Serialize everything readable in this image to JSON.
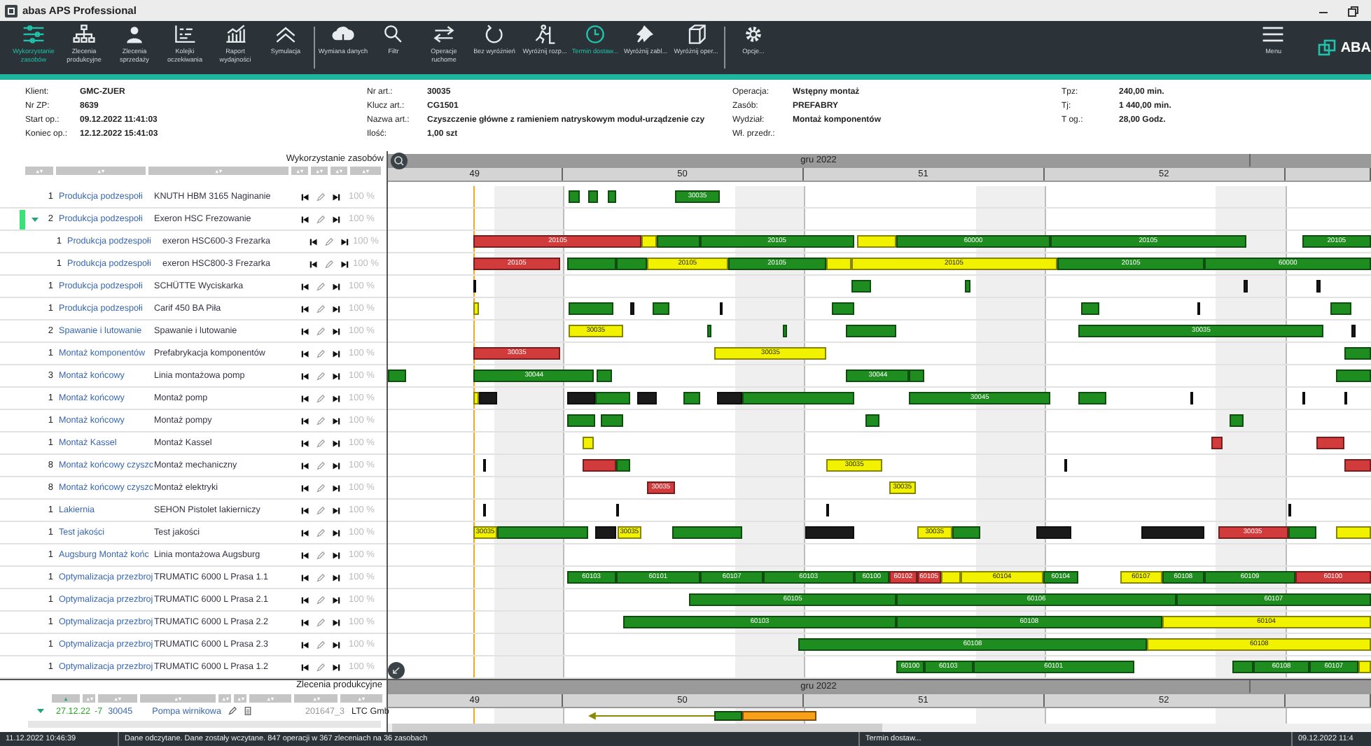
{
  "window": {
    "title": "abas APS Professional"
  },
  "toolbar": {
    "groups": [
      [
        {
          "label": "Wykorzystanie zasobów",
          "kind": "sliders",
          "selected": true
        },
        {
          "label": "Zlecenia produkcyjne",
          "kind": "org",
          "selected": false
        },
        {
          "label": "Zlecenia sprzedaży",
          "kind": "person",
          "selected": false
        },
        {
          "label": "Kolejki oczekiwania",
          "kind": "queue",
          "selected": false
        },
        {
          "label": "Raport wydajności",
          "kind": "chart",
          "selected": false
        },
        {
          "label": "Symulacja",
          "kind": "chevrons",
          "selected": false
        }
      ],
      [
        {
          "label": "Wymiana danych",
          "kind": "cloud",
          "selected": false
        },
        {
          "label": "Filtr",
          "kind": "search",
          "selected": false
        },
        {
          "label": "Operacje ruchome",
          "kind": "arrows",
          "selected": false
        },
        {
          "label": "Bez wyróżnień",
          "kind": "refresh",
          "selected": false
        },
        {
          "label": "Wyróżnij rozp...",
          "kind": "runner",
          "selected": false
        },
        {
          "label": "Termin dostaw...",
          "kind": "clock",
          "selected": true
        },
        {
          "label": "Wyróżnij zabl...",
          "kind": "pin",
          "selected": false
        },
        {
          "label": "Wyróżnij oper...",
          "kind": "cube",
          "selected": false
        }
      ],
      [
        {
          "label": "Opcje...",
          "kind": "gear",
          "selected": false
        }
      ]
    ],
    "menu": "Menu",
    "logo": "ABA"
  },
  "info": {
    "columns": [
      [
        {
          "label": "Klient:",
          "value": "GMC-ZUER"
        },
        {
          "label": "Nr ZP:",
          "value": "8639"
        },
        {
          "label": "Start op.:",
          "value": "09.12.2022 11:41:03"
        },
        {
          "label": "Koniec op.:",
          "value": "12.12.2022 15:41:03"
        }
      ],
      [
        {
          "label": "Nr art.:",
          "value": "30035"
        },
        {
          "label": "Klucz art.:",
          "value": "CG1501"
        },
        {
          "label": "Nazwa art.:",
          "value": "Czyszczenie główne z ramieniem natryskowym moduł-urządzenie czy"
        },
        {
          "label": "Ilość:",
          "value": "1,00 szt"
        }
      ],
      [
        {
          "label": "Operacja:",
          "value": "Wstępny montaż"
        },
        {
          "label": "Zasób:",
          "value": "PREFABRY"
        },
        {
          "label": "Wydział:",
          "value": "Montaż komponentów"
        },
        {
          "label": "Wł. przedr.:"
        }
      ],
      [
        {
          "label": "Tpz:",
          "value": "240,00 min."
        },
        {
          "label": "Tj:",
          "value": "1 440,00 min."
        },
        {
          "label": "T og.:",
          "value": "28,00 Godz."
        }
      ]
    ]
  },
  "resources": {
    "title": "Wykorzystanie zasobów",
    "timeline": {
      "month": "gru 2022",
      "weeks": [
        "49",
        "50",
        "51",
        "52"
      ]
    },
    "rows": [
      {
        "count": "1",
        "group": "Produkcja podzespołi",
        "resource": "KNUTH HBM 3165 Naginanie",
        "load": "100 %",
        "selected": false,
        "bars": [
          {
            "color": "#1e8c1e"
          },
          {
            "color": "#1e8c1e"
          },
          {
            "color": "#1e8c1e"
          },
          {
            "color": "#1e8c1e",
            "label": "30035"
          }
        ]
      },
      {
        "count": "2",
        "group": "Produkcja podzespołi",
        "resource": "Exeron HSC  Frezowanie",
        "load": "100 %",
        "selected": true,
        "expanded": true,
        "bars": [],
        "children": [
          {
            "count": "1",
            "group": "Produkcja podzespołi",
            "resource": "exeron HSC600-3 Frezarka",
            "load": "100 %",
            "bars": [
              {
                "color": "#d23b3b",
                "label": "20105"
              },
              {
                "color": "#f2f200"
              },
              {
                "color": "#1e8c1e"
              },
              {
                "color": "#1e8c1e",
                "label": "20105"
              },
              {
                "color": "#f2f200"
              },
              {
                "color": "#1e8c1e",
                "label": "60000"
              },
              {
                "color": "#1e8c1e",
                "label": "20105"
              },
              {
                "color": "#1e8c1e",
                "label": "20105"
              }
            ]
          },
          {
            "count": "1",
            "group": "Produkcja podzespołi",
            "resource": "exeron HSC800-3 Frezarka",
            "load": "100 %",
            "bars": [
              {
                "color": "#d23b3b",
                "label": "20105"
              },
              {
                "color": "#1e8c1e"
              },
              {
                "color": "#1e8c1e"
              },
              {
                "color": "#f2f200",
                "label": "20105"
              },
              {
                "color": "#1e8c1e",
                "label": "20105"
              },
              {
                "color": "#f2f200"
              },
              {
                "color": "#f2f200",
                "label": "20105"
              },
              {
                "color": "#1e8c1e",
                "label": "20105"
              },
              {
                "color": "#1e8c1e",
                "label": "60000"
              }
            ]
          }
        ]
      },
      {
        "count": "1",
        "group": "Produkcja podzespołi",
        "resource": "SCHÜTTE Wyciskarka",
        "load": "100 %",
        "selected": false,
        "bars": [
          {
            "color": "#1a1a1a"
          },
          {
            "color": "#1e8c1e"
          },
          {
            "color": "#1e8c1e"
          },
          {
            "color": "#1a1a1a"
          },
          {
            "color": "#1a1a1a"
          }
        ]
      },
      {
        "count": "1",
        "group": "Produkcja podzespołi",
        "resource": "Carif 450 BA Piła",
        "load": "100 %",
        "selected": false,
        "bars": [
          {
            "color": "#f2f200"
          },
          {
            "color": "#1e8c1e"
          },
          {
            "color": "#1a1a1a"
          },
          {
            "color": "#1e8c1e"
          },
          {
            "color": "#1a1a1a"
          },
          {
            "color": "#1e8c1e"
          },
          {
            "color": "#1e8c1e"
          },
          {
            "color": "#1a1a1a"
          },
          {
            "color": "#1e8c1e"
          }
        ]
      },
      {
        "count": "2",
        "group": "Spawanie i lutowanie",
        "resource": "Spawanie i lutowanie",
        "load": "100 %",
        "selected": false,
        "bars": [
          {
            "color": "#f2f200",
            "label": "30035"
          },
          {
            "color": "#1e8c1e"
          },
          {
            "color": "#1e8c1e"
          },
          {
            "color": "#1e8c1e"
          },
          {
            "color": "#1e8c1e",
            "label": "30035"
          },
          {
            "color": "#1a1a1a"
          }
        ]
      },
      {
        "count": "1",
        "group": "Montaż komponentów",
        "resource": "Prefabrykacja komponentów",
        "load": "100 %",
        "selected": false,
        "bars": [
          {
            "color": "#d23b3b",
            "label": "30035"
          },
          {
            "color": "#f2f200",
            "label": "30035"
          },
          {
            "color": "#1e8c1e"
          }
        ]
      },
      {
        "count": "3",
        "group": "Montaż końcowy",
        "resource": "Linia montażowa pomp",
        "load": "100 %",
        "selected": false,
        "bars": [
          {
            "color": "#1e8c1e"
          },
          {
            "color": "#1e8c1e",
            "label": "30044"
          },
          {
            "color": "#1e8c1e"
          },
          {
            "color": "#1e8c1e",
            "label": "30044"
          },
          {
            "color": "#1e8c1e"
          },
          {
            "color": "#1e8c1e"
          }
        ]
      },
      {
        "count": "1",
        "group": "Montaż końcowy",
        "resource": "Montaż pomp",
        "load": "100 %",
        "selected": false,
        "bars": [
          {
            "color": "#f2f200"
          },
          {
            "color": "#1a1a1a"
          },
          {
            "color": "#1a1a1a"
          },
          {
            "color": "#1e8c1e"
          },
          {
            "color": "#1a1a1a"
          },
          {
            "color": "#1e8c1e"
          },
          {
            "color": "#1a1a1a"
          },
          {
            "color": "#1e8c1e"
          },
          {
            "color": "#1e8c1e",
            "label": "30045"
          },
          {
            "color": "#1e8c1e"
          },
          {
            "color": "#1a1a1a"
          },
          {
            "color": "#1a1a1a"
          },
          {
            "color": "#1a1a1a"
          }
        ]
      },
      {
        "count": "1",
        "group": "Montaż końcowy",
        "resource": "Montaż pompy",
        "load": "100 %",
        "selected": false,
        "bars": [
          {
            "color": "#1e8c1e"
          },
          {
            "color": "#1e8c1e"
          },
          {
            "color": "#1e8c1e"
          },
          {
            "color": "#1e8c1e"
          }
        ]
      },
      {
        "count": "1",
        "group": "Montaż Kassel",
        "resource": "Montaż Kassel",
        "load": "100 %",
        "selected": false,
        "bars": [
          {
            "color": "#f2f200"
          },
          {
            "color": "#d23b3b"
          },
          {
            "color": "#d23b3b"
          }
        ]
      },
      {
        "count": "8",
        "group": "Montaż końcowy czyszc",
        "resource": "Montaż mechaniczny",
        "load": "100 %",
        "selected": false,
        "bars": [
          {
            "color": "#1a1a1a"
          },
          {
            "color": "#d23b3b"
          },
          {
            "color": "#1e8c1e"
          },
          {
            "color": "#f2f200",
            "label": "30035"
          },
          {
            "color": "#1a1a1a"
          },
          {
            "color": "#d23b3b"
          }
        ]
      },
      {
        "count": "8",
        "group": "Montaż końcowy czyszc",
        "resource": "Montaż elektryki",
        "load": "100 %",
        "selected": false,
        "bars": [
          {
            "color": "#d23b3b",
            "label": "30035"
          },
          {
            "color": "#f2f200",
            "label": "30035"
          }
        ]
      },
      {
        "count": "1",
        "group": "Lakiernia",
        "resource": "SEHON Pistolet lakierniczy",
        "load": "100 %",
        "selected": false,
        "bars": [
          {
            "color": "#1a1a1a"
          },
          {
            "color": "#1a1a1a"
          },
          {
            "color": "#1a1a1a"
          },
          {
            "color": "#1a1a1a"
          }
        ]
      },
      {
        "count": "1",
        "group": "Test jakości",
        "resource": "Test jakości",
        "load": "100 %",
        "selected": false,
        "bars": [
          {
            "color": "#f2f200",
            "label": "30035"
          },
          {
            "color": "#1e8c1e"
          },
          {
            "color": "#1a1a1a"
          },
          {
            "color": "#f2f200",
            "label": "30035"
          },
          {
            "color": "#1e8c1e"
          },
          {
            "color": "#1a1a1a"
          },
          {
            "color": "#f2f200",
            "label": "30035"
          },
          {
            "color": "#1e8c1e"
          },
          {
            "color": "#1a1a1a"
          },
          {
            "color": "#1a1a1a"
          },
          {
            "color": "#d23b3b",
            "label": "30035"
          },
          {
            "color": "#1e8c1e"
          },
          {
            "color": "#f2f200"
          }
        ]
      },
      {
        "count": "1",
        "group": "Augsburg Montaż końc",
        "resource": "Linia montażowa Augsburg",
        "load": "100 %",
        "selected": false,
        "bars": []
      },
      {
        "count": "1",
        "group": "Optymalizacja przezbroj",
        "resource": "TRUMATIC 6000 L Prasa 1.1",
        "load": "100 %",
        "selected": false,
        "bars": [
          {
            "color": "#1e8c1e",
            "label": "60103"
          },
          {
            "color": "#1e8c1e",
            "label": "60101"
          },
          {
            "color": "#1e8c1e",
            "label": "60107"
          },
          {
            "color": "#1e8c1e",
            "label": "60103"
          },
          {
            "color": "#1e8c1e",
            "label": "60100"
          },
          {
            "color": "#d23b3b",
            "label": "60102"
          },
          {
            "color": "#d23b3b",
            "label": "60105"
          },
          {
            "color": "#f2f200"
          },
          {
            "color": "#f2f200",
            "label": "60104"
          },
          {
            "color": "#1e8c1e",
            "label": "60104"
          },
          {
            "color": "#f2f200",
            "label": "60107"
          },
          {
            "color": "#1e8c1e",
            "label": "60108"
          },
          {
            "color": "#1e8c1e",
            "label": "60109"
          },
          {
            "color": "#d23b3b",
            "label": "60100"
          }
        ]
      },
      {
        "count": "1",
        "group": "Optymalizacja przezbroj",
        "resource": "TRUMATIC 6000 L Prasa 2.1",
        "load": "100 %",
        "selected": false,
        "bars": [
          {
            "color": "#1e8c1e",
            "label": "60105"
          },
          {
            "color": "#1e8c1e",
            "label": "60106"
          },
          {
            "color": "#1e8c1e",
            "label": "60107"
          }
        ]
      },
      {
        "count": "1",
        "group": "Optymalizacja przezbroj",
        "resource": "TRUMATIC 6000 L Prasa 2.2",
        "load": "100 %",
        "selected": false,
        "bars": [
          {
            "color": "#1e8c1e",
            "label": "60103"
          },
          {
            "color": "#1e8c1e",
            "label": "60108"
          },
          {
            "color": "#f2f200",
            "label": "60104"
          }
        ]
      },
      {
        "count": "1",
        "group": "Optymalizacja przezbroj",
        "resource": "TRUMATIC 6000 L Prasa 2.3",
        "load": "100 %",
        "selected": false,
        "bars": [
          {
            "color": "#1e8c1e",
            "label": "60108"
          },
          {
            "color": "#f2f200",
            "label": "60108"
          }
        ]
      },
      {
        "count": "1",
        "group": "Optymalizacja przezbroj",
        "resource": "TRUMATIC 6000 L Prasa 1.2",
        "load": "100 %",
        "selected": false,
        "bars": [
          {
            "color": "#1e8c1e",
            "label": "60100"
          },
          {
            "color": "#1e8c1e",
            "label": "60103"
          },
          {
            "color": "#1e8c1e",
            "label": "60101"
          },
          {
            "color": "#1e8c1e"
          },
          {
            "color": "#1e8c1e",
            "label": "60108"
          },
          {
            "color": "#1e8c1e",
            "label": "60107"
          },
          {
            "color": "#f2f200"
          }
        ]
      }
    ]
  },
  "orders": {
    "title": "Zlecenia produkcyjne",
    "timeline": {
      "month": "gru 2022",
      "weeks": [
        "49",
        "50",
        "51",
        "52"
      ]
    },
    "rows": [
      {
        "expanded": false,
        "date": "27.12.22",
        "delay": "-7",
        "article": "30045",
        "name": "Pompa wirnikowa",
        "number": "201647_3",
        "client": "LTC Gmb",
        "bars": [
          {
            "kind": "link",
            "color": "#8a8a00"
          },
          {
            "kind": "bar",
            "color": "#1e8c1e"
          },
          {
            "kind": "bar",
            "color": "#f7a11a"
          }
        ]
      }
    ]
  },
  "status_bar": [
    "11.12.2022 10:46:39",
    "Dane odczytane. Dane zostały wczytane. 847 operacji w 367 zleceniach na 36 zasobach",
    "Termin dostaw...",
    "09.12.2022 11:4"
  ]
}
